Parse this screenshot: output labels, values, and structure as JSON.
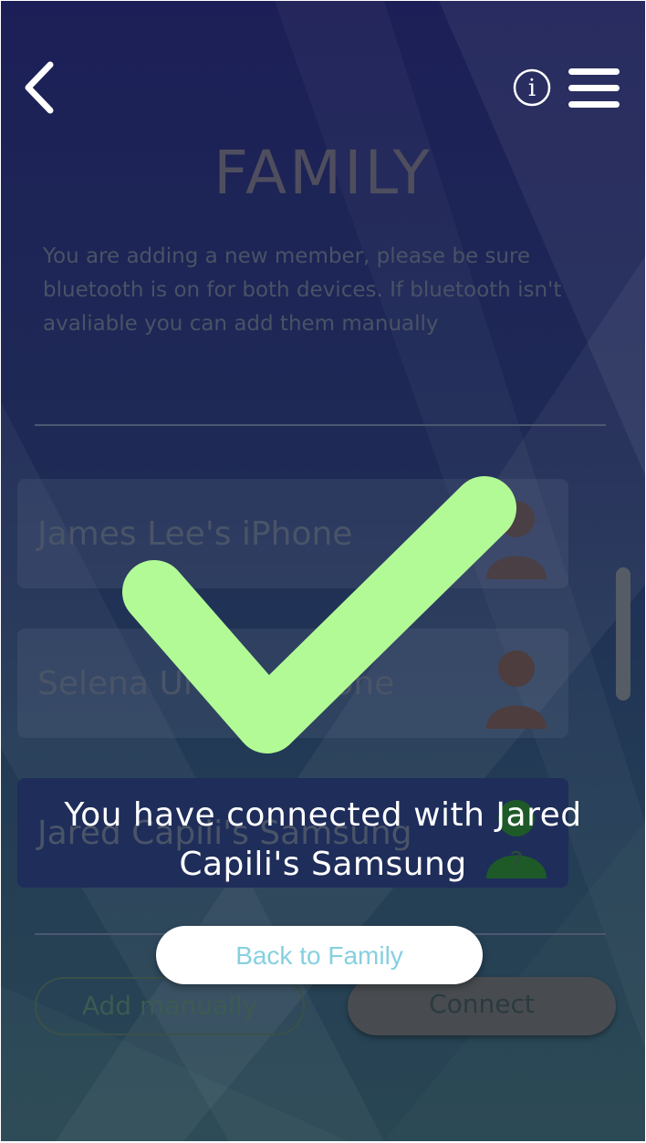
{
  "header": {
    "back_icon": "chevron-left-icon",
    "info_icon": "info-icon",
    "menu_icon": "hamburger-menu-icon"
  },
  "page": {
    "title": "FAMILY",
    "description": "You are adding a new member, please be sure bluetooth is on for both devices. If bluetooth isn't avaliable you can add them manually"
  },
  "devices": [
    {
      "name": "James Lee's iPhone",
      "icon": "person-icon"
    },
    {
      "name": "Selena Uribe's iPhone",
      "icon": "person-icon"
    },
    {
      "name": "Jared Capili's Samsung",
      "icon": "person-question-icon"
    }
  ],
  "actions": {
    "add_manually": "Add manually",
    "connect": "Connect"
  },
  "success_overlay": {
    "icon": "checkmark-icon",
    "message": "You have connected with Jared Capili's Samsung",
    "back_button": "Back to Family"
  },
  "colors": {
    "check": "#b2fa96",
    "bg_top": "#1c1f57",
    "bg_bottom": "#294653",
    "back_button_text": "#86d0e0"
  }
}
